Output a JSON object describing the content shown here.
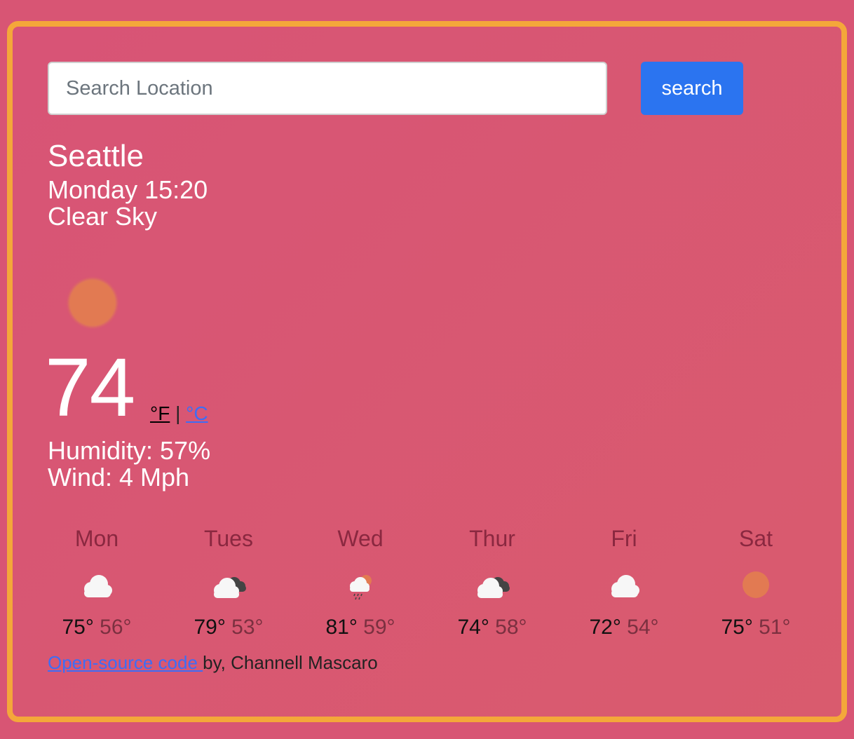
{
  "search": {
    "placeholder": "Search Location",
    "button_label": "search"
  },
  "current": {
    "city": "Seattle",
    "datetime": "Monday 15:20",
    "description": "Clear Sky",
    "icon": "sun-icon",
    "temperature": "74",
    "unit_f": "°F",
    "unit_separator": "|",
    "unit_c": "°C",
    "humidity": "Humidity: 57%",
    "wind": "Wind: 4 Mph"
  },
  "forecast": [
    {
      "day": "Mon",
      "icon": "cloud-icon",
      "max": "75°",
      "min": "56°"
    },
    {
      "day": "Tues",
      "icon": "cloudy-icon",
      "max": "79°",
      "min": "53°"
    },
    {
      "day": "Wed",
      "icon": "rain-sun-icon",
      "max": "81°",
      "min": "59°"
    },
    {
      "day": "Thur",
      "icon": "cloudy-icon",
      "max": "74°",
      "min": "58°"
    },
    {
      "day": "Fri",
      "icon": "cloud-icon",
      "max": "72°",
      "min": "54°"
    },
    {
      "day": "Sat",
      "icon": "sun-icon",
      "max": "75°",
      "min": "51°"
    }
  ],
  "footer": {
    "link_text": "Open-source code ",
    "credit": "by, Channell Mascaro"
  },
  "colors": {
    "background": "#d85574",
    "border": "#f4a73a",
    "button": "#2b74f0",
    "sun": "#e27a52"
  }
}
